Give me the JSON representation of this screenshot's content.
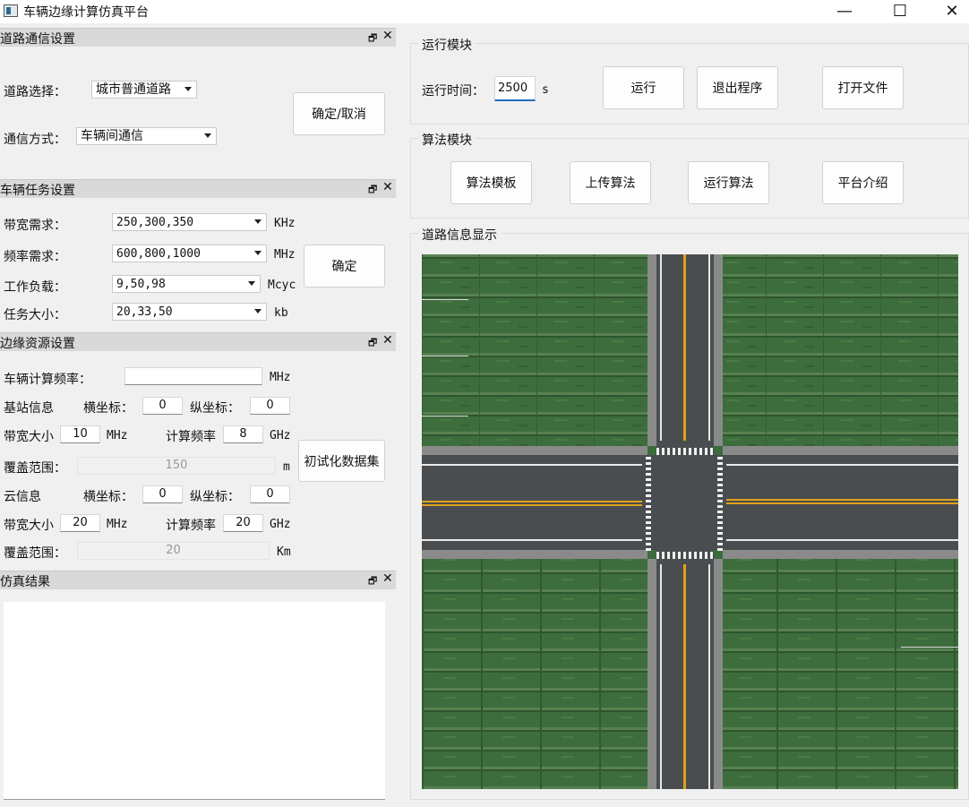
{
  "window": {
    "title": "车辆边缘计算仿真平台",
    "minimize_glyph": "—",
    "maximize_glyph": "☐",
    "close_glyph": "✕"
  },
  "dock_controls": {
    "float_glyph": "🗗",
    "close_glyph": "✕"
  },
  "road_comm": {
    "header": "道路通信设置",
    "road_label": "道路选择：",
    "road_value": "城市普通道路",
    "comm_label": "通信方式：",
    "comm_value": "车辆间通信",
    "confirm_button": "确定/取消"
  },
  "vehicle_task": {
    "header": "车辆任务设置",
    "bandwidth_label": "带宽需求：",
    "bandwidth_value": "250,300,350",
    "bandwidth_unit": "KHz",
    "freq_label": "频率需求：",
    "freq_value": "600,800,1000",
    "freq_unit": "MHz",
    "workload_label": "工作负载：",
    "workload_value": "9,50,98",
    "workload_unit": "Mcyc",
    "size_label": "任务大小：",
    "size_value": "20,33,50",
    "size_unit": "kb",
    "confirm_button": "确定"
  },
  "edge_resource": {
    "header": "边缘资源设置",
    "vehicle_freq_label": "车辆计算频率：",
    "vehicle_freq_value": "",
    "vehicle_freq_unit": "MHz",
    "bs_label": "基站信息",
    "bs_x_label": "横坐标：",
    "bs_x_value": "0",
    "bs_y_label": "纵坐标：",
    "bs_y_value": "0",
    "bs_bw_label": "带宽大小",
    "bs_bw_value": "10",
    "bs_bw_unit": "MHz",
    "bs_freq_label": "计算频率",
    "bs_freq_value": "8",
    "bs_freq_unit": "GHz",
    "bs_cov_label": "覆盖范围：",
    "bs_cov_value": "150",
    "bs_cov_unit": "m",
    "init_button": "初试化数据集",
    "cloud_label": "云信息",
    "cloud_x_label": "横坐标：",
    "cloud_x_value": "0",
    "cloud_y_label": "纵坐标：",
    "cloud_y_value": "0",
    "cloud_bw_label": "带宽大小",
    "cloud_bw_value": "20",
    "cloud_bw_unit": "MHz",
    "cloud_freq_label": "计算频率",
    "cloud_freq_value": "20",
    "cloud_freq_unit": "GHz",
    "cloud_cov_label": "覆盖范围：",
    "cloud_cov_value": "20",
    "cloud_cov_unit": "Km"
  },
  "sim_result": {
    "header": "仿真结果",
    "text": ""
  },
  "run_module": {
    "title": "运行模块",
    "time_label": "运行时间：",
    "time_value": "2500",
    "time_unit": "s",
    "run_button": "运行",
    "exit_button": "退出程序",
    "open_button": "打开文件"
  },
  "algo_module": {
    "title": "算法模块",
    "template_button": "算法模板",
    "upload_button": "上传算法",
    "run_algo_button": "运行算法",
    "intro_button": "平台介绍"
  },
  "road_display": {
    "title": "道路信息显示"
  },
  "colors": {
    "grass": "#3c6b3c",
    "road": "#4a4d4f",
    "center_line": "#e0a21a",
    "edge_line": "#e8e8e8",
    "curb": "#8a8a8a",
    "crosswalk": "#f2f2f2",
    "input_focus": "#1f6fbf"
  }
}
